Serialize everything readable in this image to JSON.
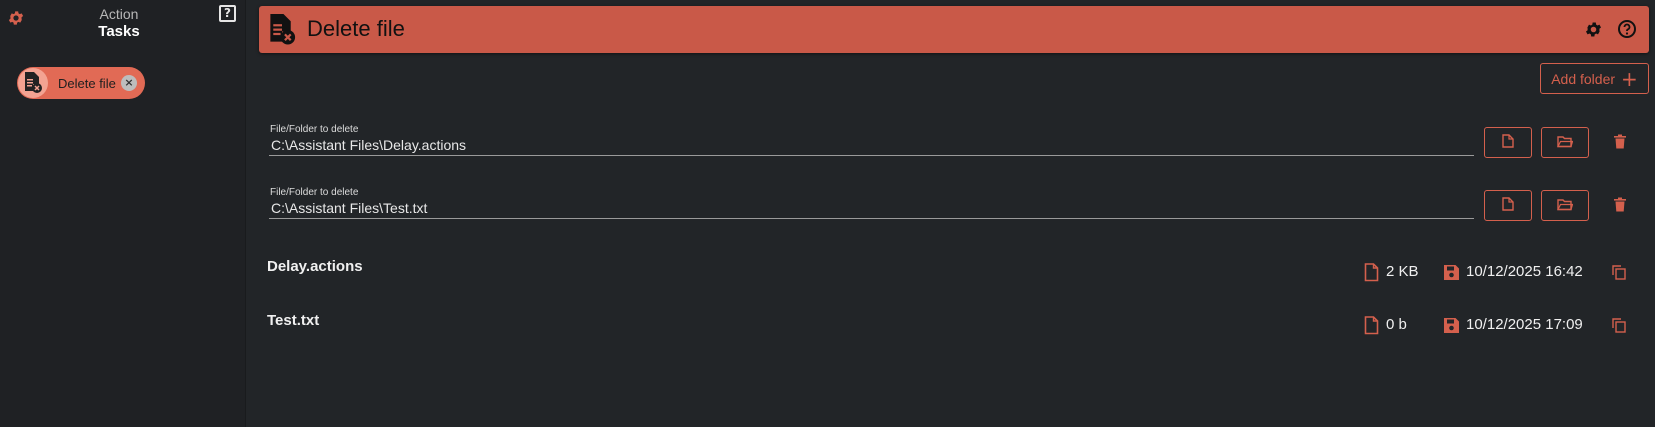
{
  "sidebar": {
    "title_top": "Action",
    "title_bottom": "Tasks",
    "help_glyph": "?",
    "task": {
      "label": "Delete file",
      "close_glyph": "×"
    }
  },
  "header": {
    "title": "Delete file"
  },
  "add_folder_label": "Add folder",
  "add_folder_plus": "+",
  "fields": [
    {
      "label": "File/Folder to delete",
      "value": "C:\\Assistant Files\\Delay.actions"
    },
    {
      "label": "File/Folder to delete",
      "value": "C:\\Assistant Files\\Test.txt"
    }
  ],
  "files": [
    {
      "name": "Delay.actions",
      "size": "2 KB",
      "modified": "10/12/2025 16:42"
    },
    {
      "name": "Test.txt",
      "size": "0 b",
      "modified": "10/12/2025 17:09"
    }
  ],
  "colors": {
    "accent": "#d4604d",
    "header_bg": "#c95948",
    "chip_bg": "#e16a55",
    "background": "#222528"
  },
  "icons": [
    "gear-icon",
    "help-icon",
    "delete-file-icon",
    "close-icon",
    "file-icon",
    "folder-open-icon",
    "trash-icon",
    "save-icon",
    "copy-icon"
  ]
}
